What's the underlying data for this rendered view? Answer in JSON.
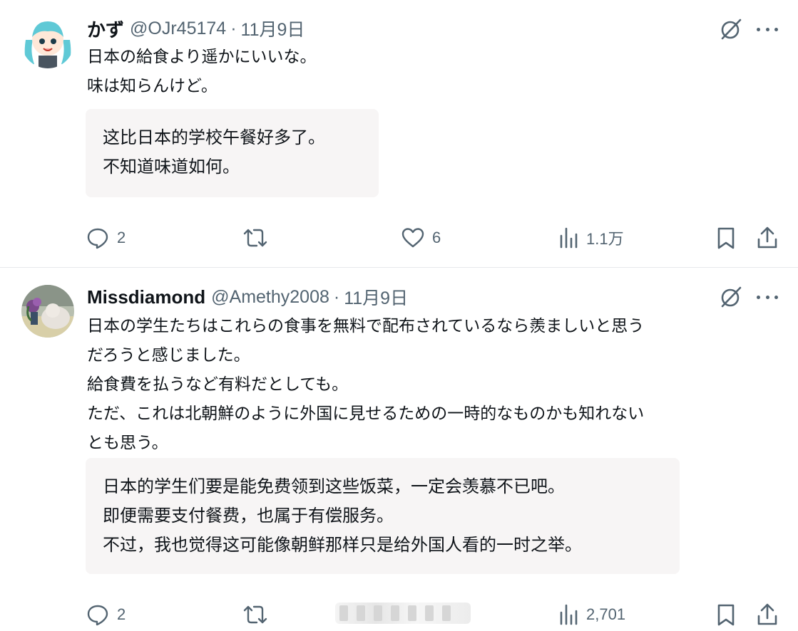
{
  "posts": [
    {
      "name": "かず",
      "handle": "@OJr45174",
      "separator": "·",
      "date": "11月9日",
      "body_lines": [
        "日本の給食より遥かにいいな。",
        "味は知らんけど。"
      ],
      "translation_lines": [
        "这比日本的学校午餐好多了。",
        "不知道味道如何。"
      ],
      "stats": {
        "replies": "2",
        "likes": "6",
        "views": "1.1万"
      }
    },
    {
      "name": "Missdiamond",
      "handle": "@Amethy2008",
      "separator": "·",
      "date": "11月9日",
      "body_lines": [
        "日本の学生たちはこれらの食事を無料で配布されているなら羨ましいと思う",
        "だろうと感じました。",
        "給食費を払うなど有料だとしても。",
        "ただ、これは北朝鮮のように外国に見せるための一時的なものかも知れない",
        "とも思う。"
      ],
      "translation_lines": [
        "日本的学生们要是能免费领到这些饭菜，一定会羡慕不已吧。",
        "即便需要支付餐费，也属于有偿服务。",
        "不过，我也觉得这可能像朝鲜那样只是给外国人看的一时之举。"
      ],
      "stats": {
        "replies": "2",
        "views": "2,701"
      }
    }
  ],
  "icons": {
    "reply": "reply-bubble-icon",
    "repost": "repost-arrows-icon",
    "like": "heart-icon",
    "views": "bar-chart-icon",
    "bookmark": "bookmark-icon",
    "share": "share-upload-icon",
    "grok": "grok-slash-circle-icon",
    "more": "more-dots-icon"
  },
  "colors": {
    "text": "#0f1419",
    "muted": "#536471",
    "translation_bg": "#f7f5f5",
    "divider": "#e6e9eb"
  }
}
